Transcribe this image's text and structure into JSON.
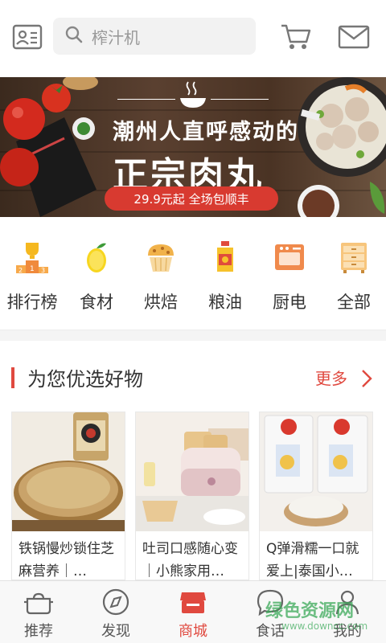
{
  "header": {
    "search_placeholder": "榨汁机"
  },
  "banner": {
    "title_line1": "潮州人直呼感动的",
    "title_line2": "正宗肉丸",
    "promo": "29.9元起 全场包顺丰"
  },
  "categories": [
    {
      "label": "排行榜",
      "icon": "trophy-icon"
    },
    {
      "label": "食材",
      "icon": "lemon-icon"
    },
    {
      "label": "烘焙",
      "icon": "muffin-icon"
    },
    {
      "label": "粮油",
      "icon": "oil-bottle-icon"
    },
    {
      "label": "厨电",
      "icon": "oven-icon"
    },
    {
      "label": "全部",
      "icon": "cabinet-icon"
    }
  ],
  "section": {
    "title": "为您优选好物",
    "more": "更多"
  },
  "products": [
    {
      "title": "铁锅慢炒锁住芝麻营养｜…"
    },
    {
      "title": "吐司口感随心变｜小熊家用…"
    },
    {
      "title": "Q弹滑糯一口就爱上|泰国小…"
    }
  ],
  "tabs": [
    {
      "label": "推荐",
      "icon": "pot-icon",
      "active": false
    },
    {
      "label": "发现",
      "icon": "compass-icon",
      "active": false
    },
    {
      "label": "商城",
      "icon": "store-icon",
      "active": true
    },
    {
      "label": "食话",
      "icon": "chat-icon",
      "active": false
    },
    {
      "label": "我的",
      "icon": "user-icon",
      "active": false
    }
  ],
  "watermark": {
    "text": "绿色资源网",
    "sub": "www.downcc.com"
  },
  "colors": {
    "accent": "#e0493f",
    "banner_pill": "#d83a30"
  }
}
